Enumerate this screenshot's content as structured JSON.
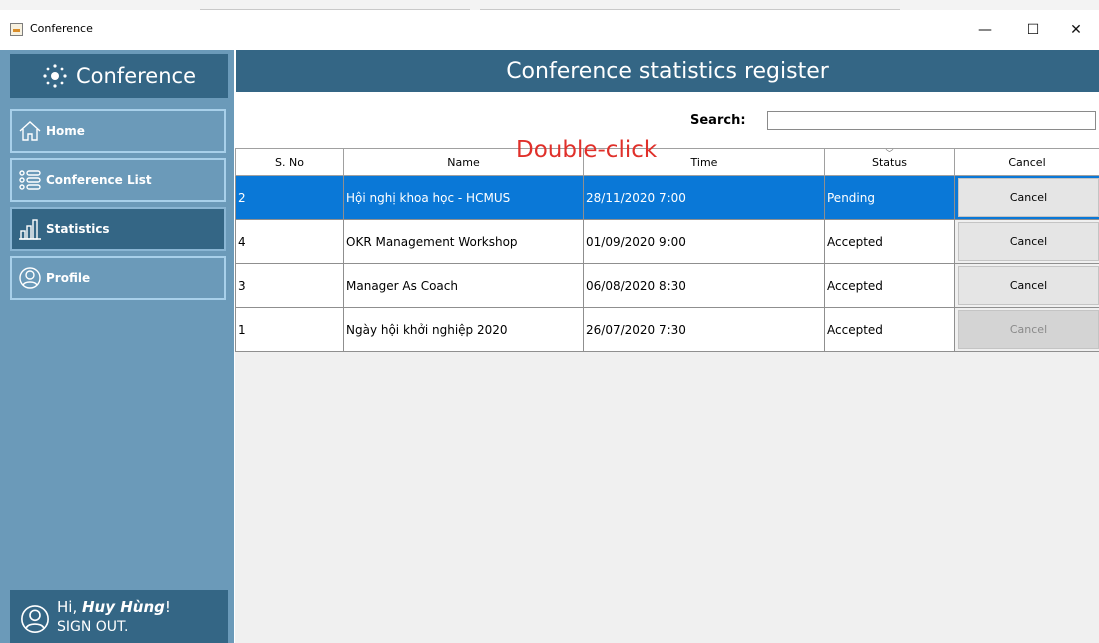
{
  "window": {
    "title": "Conference",
    "min": "—",
    "max": "☐",
    "close": "✕"
  },
  "sidebar": {
    "logo": "Conference",
    "items": [
      {
        "label": "Home",
        "icon": "home-icon"
      },
      {
        "label": "Conference List",
        "icon": "list-icon"
      },
      {
        "label": "Statistics",
        "icon": "bar-chart-icon"
      },
      {
        "label": "Profile",
        "icon": "user-icon"
      }
    ],
    "user": {
      "greeting": "Hi, ",
      "name": "Huy Hùng",
      "suffix": "!",
      "signout": "SIGN OUT."
    }
  },
  "header": {
    "title": "Conference statistics register"
  },
  "search": {
    "label": "Search:",
    "value": ""
  },
  "overlay_text": "Double-click",
  "table": {
    "columns": [
      "S. No",
      "Name",
      "Time",
      "Status",
      "Cancel"
    ],
    "rows": [
      {
        "no": "2",
        "name": "Hội nghị khoa học - HCMUS",
        "time": "28/11/2020 7:00",
        "status": "Pending",
        "cancel": "Cancel"
      },
      {
        "no": "4",
        "name": "OKR Management Workshop",
        "time": "01/09/2020 9:00",
        "status": "Accepted",
        "cancel": "Cancel"
      },
      {
        "no": "3",
        "name": "Manager As Coach",
        "time": "06/08/2020 8:30",
        "status": "Accepted",
        "cancel": "Cancel"
      },
      {
        "no": "1",
        "name": "Ngày hội khởi nghiệp 2020",
        "time": "26/07/2020 7:30",
        "status": "Accepted",
        "cancel": "Cancel"
      }
    ]
  },
  "colors": {
    "dark": "#346685",
    "light": "#6b9ab9",
    "selected": "#0a78d7",
    "overlay": "#e0302a"
  }
}
